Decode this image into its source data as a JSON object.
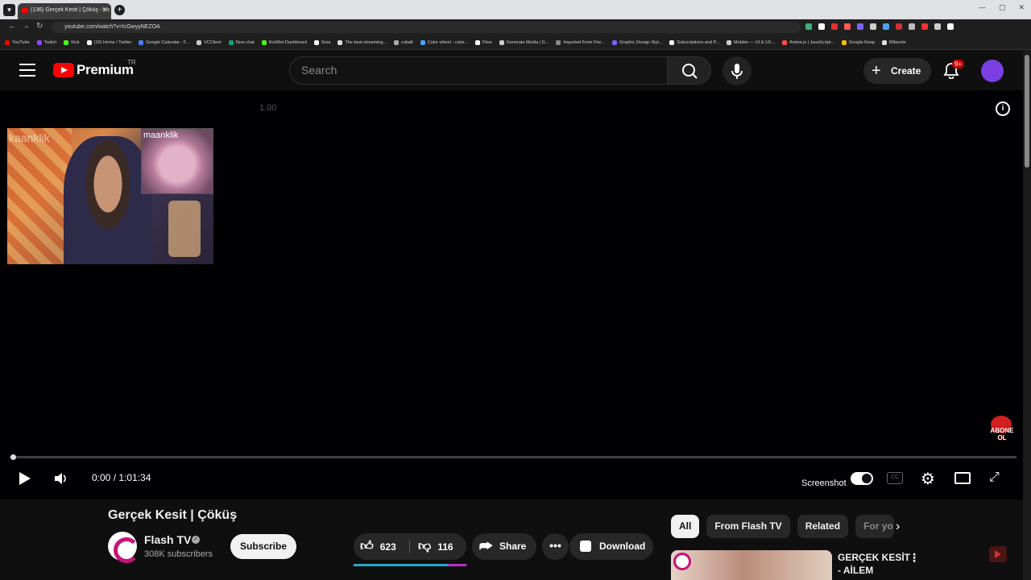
{
  "browser": {
    "tab_title": "(136) Gerçek Kesit | Çöküş - Yo",
    "tab_close": "✕",
    "new_tab": "+",
    "url": "youtube.com/watch?v=IcGwyyNEZOA",
    "bookmarks": [
      {
        "label": "YouTube",
        "color": "#ff0000"
      },
      {
        "label": "Twitch",
        "color": "#9146ff"
      },
      {
        "label": "Kick",
        "color": "#53fc18"
      },
      {
        "label": "(10) Home / Twitter",
        "color": "#ffffff"
      },
      {
        "label": "Google Calendar - F...",
        "color": "#4285f4"
      },
      {
        "label": "VCClient",
        "color": "#cccccc"
      },
      {
        "label": "New chat",
        "color": "#10a37f"
      },
      {
        "label": "KickBot Dashboard",
        "color": "#53fc18"
      },
      {
        "label": "Sora",
        "color": "#ffffff"
      },
      {
        "label": "The best streaming...",
        "color": "#dddddd"
      },
      {
        "label": "cobalt",
        "color": "#aaaaaa"
      },
      {
        "label": "Color wheel - color...",
        "color": "#4aa3ff"
      },
      {
        "label": "Flow",
        "color": "#ffffff"
      },
      {
        "label": "Generate Media | G...",
        "color": "#cccccc"
      },
      {
        "label": "Imported From Fire...",
        "color": "#888888"
      },
      {
        "label": "Graphic Design Styl...",
        "color": "#7b61ff"
      },
      {
        "label": "Subscriptions and P...",
        "color": "#ffffff"
      },
      {
        "label": "Mobbin — UI & UX...",
        "color": "#cccccc"
      },
      {
        "label": "Anime.js | JavaScript...",
        "color": "#ff4b4b"
      },
      {
        "label": "Google Keep",
        "color": "#fbbc04"
      },
      {
        "label": "Milanote",
        "color": "#dddddd"
      }
    ]
  },
  "header": {
    "logo_text": "Premium",
    "country_code": "TR",
    "search_placeholder": "Search",
    "create_label": "Create",
    "notifications_badge": "9+"
  },
  "player": {
    "speed_label": "1.00",
    "overlay_label_left": "kaanklik",
    "overlay_label_right": "maanklik",
    "abone_text": "ABONE OL",
    "time": "0:00 / 1:01:34",
    "screenshot_label": "Screenshot",
    "cc_label": "CC",
    "progress_fraction": 0.0
  },
  "video": {
    "title": "Gerçek Kesit | Çöküş",
    "channel_name": "Flash TV",
    "subscribers": "308K subscribers",
    "subscribe_label": "Subscribe",
    "likes": "623",
    "dislikes": "116",
    "share_label": "Share",
    "download_label": "Download",
    "like_ratio": 0.84
  },
  "sidebar": {
    "chips": [
      "All",
      "From Flash TV",
      "Related",
      "For yo"
    ],
    "recommendation_title": "GERÇEK KESİT - AİLEM"
  }
}
